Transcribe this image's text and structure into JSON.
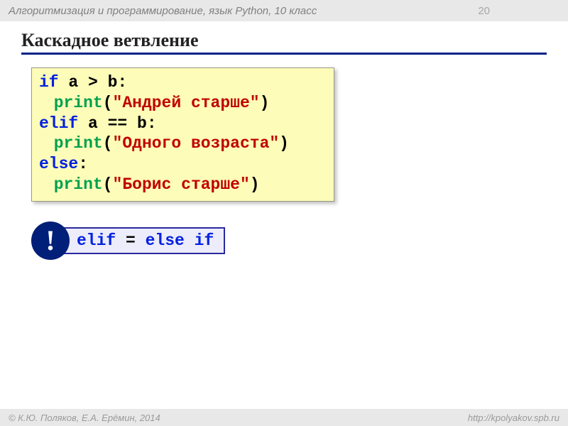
{
  "header": {
    "course": "Алгоритмизация и программирование, язык Python, 10 класс",
    "page_number": "20"
  },
  "title": "Каскадное ветвление",
  "code": {
    "line1_if": "if",
    "line1_cond": " a > b:",
    "line2_func": "print",
    "line2_open": "(",
    "line2_str": "\"Андрей старше\"",
    "line2_close": ")",
    "line3_elif": "elif",
    "line3_cond": " a == b:",
    "line4_func": "print",
    "line4_open": "(",
    "line4_str": "\"Одного возраста\"",
    "line4_close": ")",
    "line5_else": "else",
    "line5_colon": ":",
    "line6_func": "print",
    "line6_open": "(",
    "line6_str": "\"Борис старше\"",
    "line6_close": ")"
  },
  "note": {
    "exclaim": "!",
    "elif": "elif",
    "eq": " = ",
    "else": "else",
    "sp": " ",
    "if": "if"
  },
  "footer": {
    "left": "© К.Ю. Поляков, Е.А. Ерёмин, 2014",
    "right": "http://kpolyakov.spb.ru"
  }
}
